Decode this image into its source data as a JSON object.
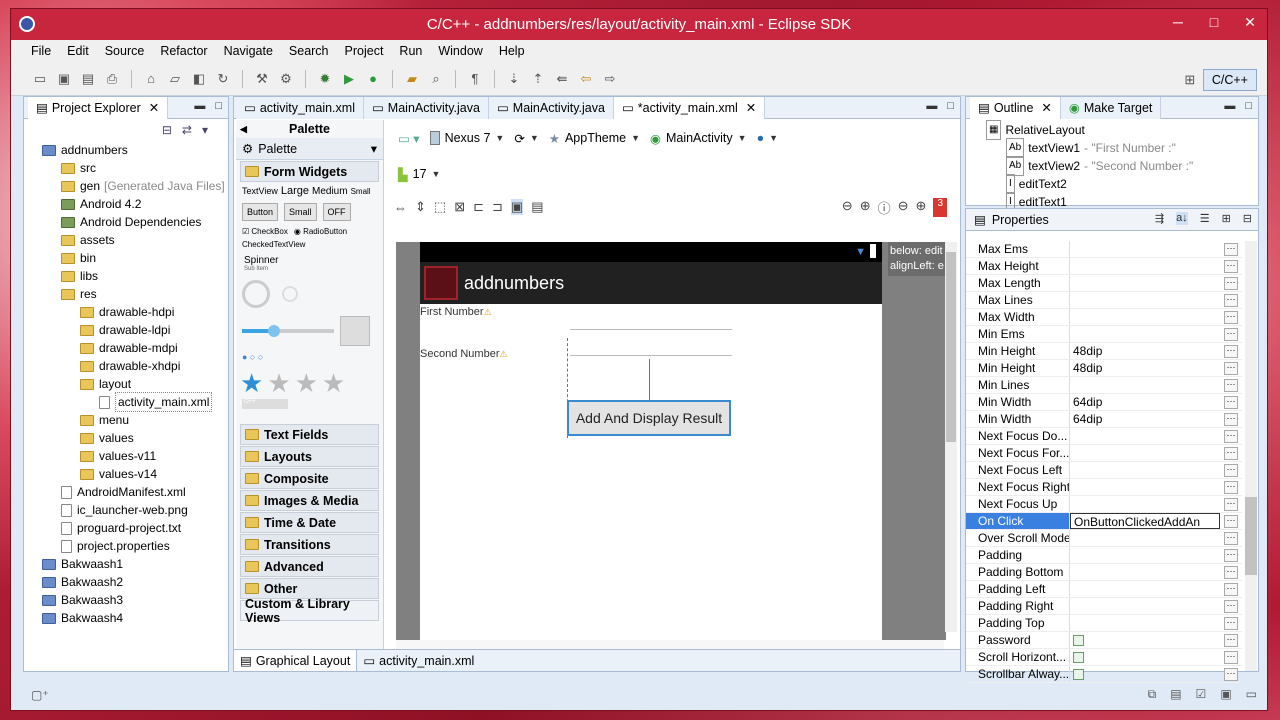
{
  "window": {
    "title": "C/C++ - addnumbers/res/layout/activity_main.xml - Eclipse SDK",
    "controls": [
      "─",
      "□",
      "✕"
    ]
  },
  "menu": [
    "File",
    "Edit",
    "Source",
    "Refactor",
    "Navigate",
    "Search",
    "Project",
    "Run",
    "Window",
    "Help"
  ],
  "perspective": {
    "label": "C/C++"
  },
  "project_explorer": {
    "title": "Project Explorer",
    "items": [
      {
        "label": "addnumbers",
        "indent": 0,
        "icon": "project"
      },
      {
        "label": "src",
        "indent": 1,
        "icon": "folder"
      },
      {
        "label": "gen",
        "suffix": "[Generated Java Files]",
        "indent": 1,
        "icon": "folder"
      },
      {
        "label": "Android 4.2",
        "indent": 1,
        "icon": "jar"
      },
      {
        "label": "Android Dependencies",
        "indent": 1,
        "icon": "jar"
      },
      {
        "label": "assets",
        "indent": 1,
        "icon": "folder"
      },
      {
        "label": "bin",
        "indent": 1,
        "icon": "folder"
      },
      {
        "label": "libs",
        "indent": 1,
        "icon": "folder"
      },
      {
        "label": "res",
        "indent": 1,
        "icon": "folder"
      },
      {
        "label": "drawable-hdpi",
        "indent": 2,
        "icon": "folder"
      },
      {
        "label": "drawable-ldpi",
        "indent": 2,
        "icon": "folder"
      },
      {
        "label": "drawable-mdpi",
        "indent": 2,
        "icon": "folder"
      },
      {
        "label": "drawable-xhdpi",
        "indent": 2,
        "icon": "folder"
      },
      {
        "label": "layout",
        "indent": 2,
        "icon": "folder"
      },
      {
        "label": "activity_main.xml",
        "indent": 3,
        "icon": "file"
      },
      {
        "label": "menu",
        "indent": 2,
        "icon": "folder"
      },
      {
        "label": "values",
        "indent": 2,
        "icon": "folder"
      },
      {
        "label": "values-v11",
        "indent": 2,
        "icon": "folder"
      },
      {
        "label": "values-v14",
        "indent": 2,
        "icon": "folder"
      },
      {
        "label": "AndroidManifest.xml",
        "indent": 1,
        "icon": "file"
      },
      {
        "label": "ic_launcher-web.png",
        "indent": 1,
        "icon": "file"
      },
      {
        "label": "proguard-project.txt",
        "indent": 1,
        "icon": "file"
      },
      {
        "label": "project.properties",
        "indent": 1,
        "icon": "file"
      },
      {
        "label": "Bakwaash1",
        "indent": 0,
        "icon": "project"
      },
      {
        "label": "Bakwaash2",
        "indent": 0,
        "icon": "project"
      },
      {
        "label": "Bakwaash3",
        "indent": 0,
        "icon": "project"
      },
      {
        "label": "Bakwaash4",
        "indent": 0,
        "icon": "project"
      }
    ]
  },
  "editor_tabs": [
    "activity_main.xml",
    "MainActivity.java",
    "MainActivity.java",
    "*activity_main.xml"
  ],
  "palette": {
    "title": "Palette",
    "section": "Palette",
    "form_widgets": "Form Widgets",
    "text_sizes": [
      "TextView",
      "Large",
      "Medium",
      "Small"
    ],
    "buttons": [
      "Button",
      "Small",
      "OFF"
    ],
    "checks": [
      "CheckBox",
      "RadioButton"
    ],
    "checked_text": "CheckedTextView",
    "spinner": "Spinner",
    "spinner_sub": "Sub Item",
    "toggle_off": "OFF",
    "categories": [
      "Text Fields",
      "Layouts",
      "Composite",
      "Images & Media",
      "Time & Date",
      "Transitions",
      "Advanced",
      "Other"
    ],
    "custom": "Custom & Library Views"
  },
  "editor_toolbar": {
    "device": "Nexus 7",
    "theme": "AppTheme",
    "activity": "MainActivity",
    "api": "17",
    "error_count": "3"
  },
  "preview": {
    "app_title": "addnumbers",
    "first_label": "First Number",
    "second_label": "Second Number",
    "button_label": "Add And Display Result",
    "tooltip": [
      "below: edit",
      "alignLeft: e"
    ]
  },
  "bottom_tabs": [
    "Graphical Layout",
    "activity_main.xml"
  ],
  "outline": {
    "tabs": [
      "Outline",
      "Make Target"
    ],
    "items": [
      {
        "label": "RelativeLayout",
        "indent": 0
      },
      {
        "label": "textView1",
        "detail": "- \"First Number :\"",
        "indent": 1
      },
      {
        "label": "textView2",
        "detail": "- \"Second Number :\"",
        "indent": 1
      },
      {
        "label": "editText2",
        "indent": 1
      },
      {
        "label": "editText1",
        "indent": 1
      }
    ]
  },
  "properties": {
    "title": "Properties",
    "rows": [
      {
        "k": "Max Ems",
        "v": ""
      },
      {
        "k": "Max Height",
        "v": ""
      },
      {
        "k": "Max Length",
        "v": ""
      },
      {
        "k": "Max Lines",
        "v": ""
      },
      {
        "k": "Max Width",
        "v": ""
      },
      {
        "k": "Min Ems",
        "v": ""
      },
      {
        "k": "Min Height",
        "v": "48dip"
      },
      {
        "k": "Min Height",
        "v": "48dip"
      },
      {
        "k": "Min Lines",
        "v": ""
      },
      {
        "k": "Min Width",
        "v": "64dip"
      },
      {
        "k": "Min Width",
        "v": "64dip"
      },
      {
        "k": "Next Focus Do...",
        "v": ""
      },
      {
        "k": "Next Focus For...",
        "v": ""
      },
      {
        "k": "Next Focus Left",
        "v": ""
      },
      {
        "k": "Next Focus Right",
        "v": ""
      },
      {
        "k": "Next Focus Up",
        "v": ""
      },
      {
        "k": "On Click",
        "v": "OnButtonClickedAddAn",
        "selected": true
      },
      {
        "k": "Over Scroll Mode",
        "v": ""
      },
      {
        "k": "Padding",
        "v": ""
      },
      {
        "k": "Padding Bottom",
        "v": ""
      },
      {
        "k": "Padding Left",
        "v": ""
      },
      {
        "k": "Padding Right",
        "v": ""
      },
      {
        "k": "Padding Top",
        "v": ""
      },
      {
        "k": "Password",
        "v": "",
        "check": true
      },
      {
        "k": "Scroll Horizont...",
        "v": "",
        "check": true
      },
      {
        "k": "Scrollbar Alway...",
        "v": "",
        "check": true
      }
    ]
  }
}
